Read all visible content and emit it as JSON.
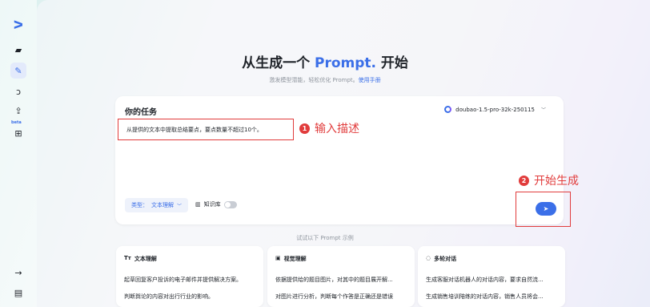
{
  "rail": {
    "beta": "beta"
  },
  "hero": {
    "title_a": "从生成一个 ",
    "title_accent": "Prompt.",
    "title_b": " 开始",
    "subtitle": "激发模型潜能，轻松优化 Prompt。",
    "manual_link": "使用手册"
  },
  "task": {
    "title": "你的任务",
    "model": "doubao-1.5-pro-32k-250115",
    "prompt_value": "从提供的文本中提取总结要点，要点数量不超过10个。",
    "type_label": "类型：",
    "type_value": "文本理解",
    "kb_label": "知识库"
  },
  "annotations": {
    "step1_num": "1",
    "step1_text": "输入描述",
    "step2_num": "2",
    "step2_text": "开始生成"
  },
  "examples": {
    "label": "试试以下 Prompt 示例",
    "cards": [
      {
        "icon": "Tт",
        "title": "文本理解",
        "line1": "起草回复客户投诉的电子邮件并提供解决方案。",
        "line2": "判断舆论的内容对出行行业的影响。"
      },
      {
        "icon": "▣",
        "title": "视觉理解",
        "line1": "依据提供给的题目图片，对其中的题目展开解...",
        "line2": "对图片进行分析，判断每个作答是正确还是错误"
      },
      {
        "icon": "◌",
        "title": "多轮对话",
        "line1": "生成客服对话机器人的对话内容，要求自然流...",
        "line2": "生成销售培训陪练的对话内容，销售人员将会..."
      }
    ]
  }
}
